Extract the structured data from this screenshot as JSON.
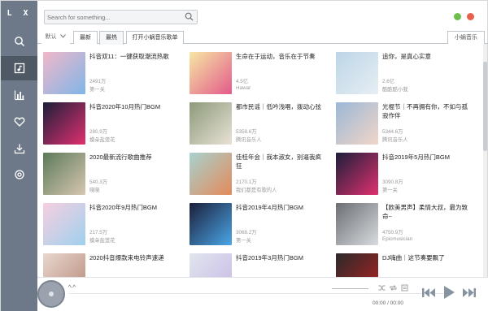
{
  "app": {
    "logo": "L X"
  },
  "search": {
    "placeholder": "Search for something..."
  },
  "sidebar": {
    "items": [
      {
        "name": "search",
        "icon": "search-icon"
      },
      {
        "name": "songlist",
        "icon": "songlist-icon",
        "active": true
      },
      {
        "name": "leaderboard",
        "icon": "bar-chart-icon"
      },
      {
        "name": "favorites",
        "icon": "heart-icon"
      },
      {
        "name": "download",
        "icon": "download-icon"
      },
      {
        "name": "settings",
        "icon": "settings-icon"
      }
    ]
  },
  "tabs": {
    "sort_label": "默认",
    "items": [
      "最新",
      "最热",
      "打开小蜗音乐歌单"
    ],
    "active": "最热",
    "source": "小蜗音乐"
  },
  "playlists": [
    {
      "title": "抖音双11：一键获取潮流热歌",
      "plays": "2491万",
      "author": "第一关"
    },
    {
      "title": "生命在于运动，音乐在于节奏",
      "plays": "4.5亿",
      "author": "Hawar"
    },
    {
      "title": "追你，是真心实意",
      "plays": "2.6亿",
      "author": "酷酷酷小我"
    },
    {
      "title": "抖音2020年10月热门BGM",
      "plays": "280.9万",
      "author": "摸朵盐莲花"
    },
    {
      "title": "都市民谣｜低吟浅唱，拨动心弦",
      "plays": "5358.6万",
      "author": "腾讯音乐人"
    },
    {
      "title": "光棍节｜不再拥有你，不如与孤寂作伴",
      "plays": "5344.6万",
      "author": "腾讯音乐人"
    },
    {
      "title": "2020最新流行歌曲推荐",
      "plays": "540.3万",
      "author": "晓晓"
    },
    {
      "title": "佳桂年会｜我本淑女，别逼我疯狂",
      "plays": "2170.1万",
      "author": "我们都是有歌的人"
    },
    {
      "title": "抖音2019年5月热门BGM",
      "plays": "3090.8万",
      "author": "第一关"
    },
    {
      "title": "抖音2020年9月热门BGM",
      "plays": "217.5万",
      "author": "摸朵盐莲花"
    },
    {
      "title": "抖音2019年4月热门BGM",
      "plays": "3068.2万",
      "author": "第一关"
    },
    {
      "title": "【欧美男声】柔情大叔，最为致命~",
      "plays": "4750.9万",
      "author": "Epicmusician"
    },
    {
      "title": "2020抖音爆款来电铃声速递",
      "plays": "",
      "author": ""
    },
    {
      "title": "抖音2019年3月热门BGM",
      "plays": "",
      "author": ""
    },
    {
      "title": "DJ嗨曲｜这节奏要飘了",
      "plays": "",
      "author": ""
    }
  ],
  "player": {
    "song": "^-^",
    "time": "00:00 / 00:00"
  },
  "colors": {
    "sidebar": "#6d7988",
    "sidebar_active": "#4f5966",
    "min_button": "#6cc04a",
    "close_button": "#e8604c"
  }
}
